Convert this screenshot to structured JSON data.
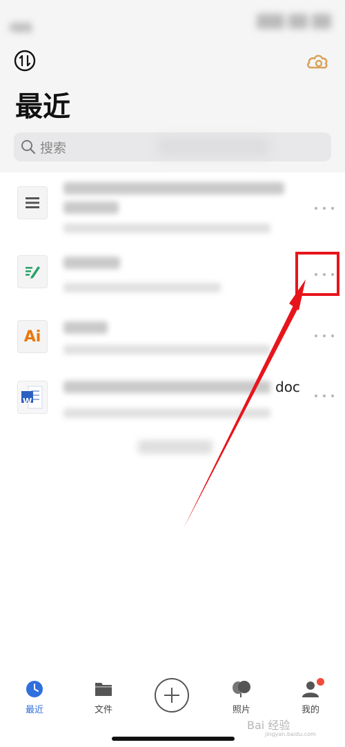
{
  "status_bar": {
    "carrier": "iQQ"
  },
  "header": {
    "title": "最近",
    "sort_icon": "sort-arrows-icon",
    "cloud_icon": "cloud-icon"
  },
  "search": {
    "placeholder": "搜索",
    "icon": "search-icon"
  },
  "files": [
    {
      "icon": "document-lines-icon",
      "name_suffix": "",
      "more": "more-options-icon"
    },
    {
      "icon": "note-pencil-icon",
      "name_suffix": "",
      "more": "more-options-icon"
    },
    {
      "icon": "adobe-illustrator-icon",
      "icon_text": "Ai",
      "name_suffix": "",
      "more": "more-options-icon"
    },
    {
      "icon": "word-document-icon",
      "icon_text": "W",
      "name_suffix": "doc",
      "more": "more-options-icon"
    }
  ],
  "tabbar": {
    "tabs": [
      {
        "label": "最近",
        "icon": "clock-icon",
        "active": true
      },
      {
        "label": "文件",
        "icon": "folder-icon"
      },
      {
        "label": "",
        "icon": "add-icon"
      },
      {
        "label": "照片",
        "icon": "photos-icon"
      },
      {
        "label": "我的",
        "icon": "profile-icon"
      }
    ]
  },
  "colors": {
    "accent": "#2f6fde",
    "annotation": "#e8141b",
    "cloud": "#d9a15a",
    "badge": "#f24b3a"
  },
  "watermark": {
    "text": "Bai 经验",
    "sub": "jingyan.baidu.com"
  }
}
